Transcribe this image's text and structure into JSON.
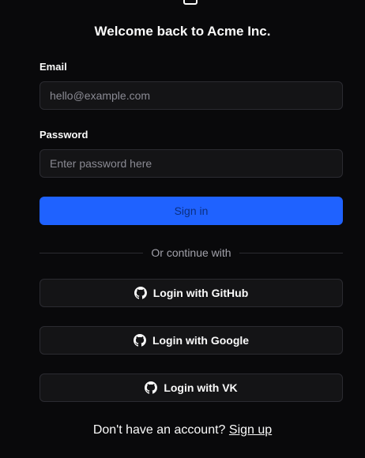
{
  "title": "Welcome back to Acme Inc.",
  "email": {
    "label": "Email",
    "placeholder": "hello@example.com",
    "value": ""
  },
  "password": {
    "label": "Password",
    "placeholder": "Enter password here",
    "value": ""
  },
  "sign_in_label": "Sign in",
  "divider_text": "Or continue with",
  "oauth": {
    "github": "Login with GitHub",
    "google": "Login with Google",
    "vk": "Login with VK",
    "icon": "github-icon"
  },
  "footer": {
    "prompt": "Don't have an account?",
    "link": "Sign up"
  },
  "colors": {
    "background": "#09090b",
    "primary": "#1f62ff",
    "field": "#141416",
    "border": "#2b2b31"
  }
}
